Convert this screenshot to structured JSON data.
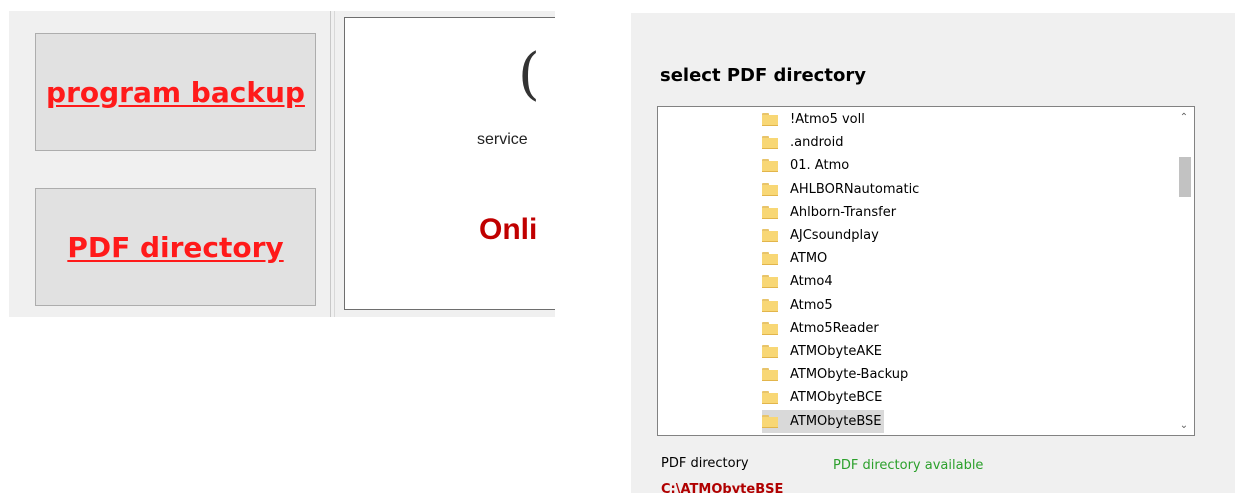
{
  "left": {
    "program_backup_label": "program backup",
    "pdf_directory_label": "PDF directory",
    "info": {
      "logo_glyph": "(",
      "service_text": "service",
      "online_text": "Onli"
    }
  },
  "dialog": {
    "title": "select PDF directory",
    "folders": [
      {
        "label": "!Atmo5 voll"
      },
      {
        "label": ".android"
      },
      {
        "label": "01. Atmo"
      },
      {
        "label": "AHLBORNautomatic"
      },
      {
        "label": "Ahlborn-Transfer"
      },
      {
        "label": "AJCsoundplay"
      },
      {
        "label": "ATMO"
      },
      {
        "label": "Atmo4"
      },
      {
        "label": "Atmo5"
      },
      {
        "label": "Atmo5Reader"
      },
      {
        "label": "ATMObyteAKE"
      },
      {
        "label": "ATMObyte-Backup"
      },
      {
        "label": "ATMObyteBCE"
      },
      {
        "label": "ATMObyteBSE",
        "selected": true
      }
    ],
    "scroll_up_icon": "chevron-up-icon",
    "scroll_down_icon": "chevron-down-icon",
    "status_label": "PDF directory",
    "status_value": "PDF directory available",
    "path": "C:\\ATMObyteBSE"
  },
  "colors": {
    "button_text": "#ff1a1a",
    "online_text": "#c00000",
    "status_ok": "#2ca02c",
    "path_text": "#b00000",
    "folder": "#f8d775"
  }
}
